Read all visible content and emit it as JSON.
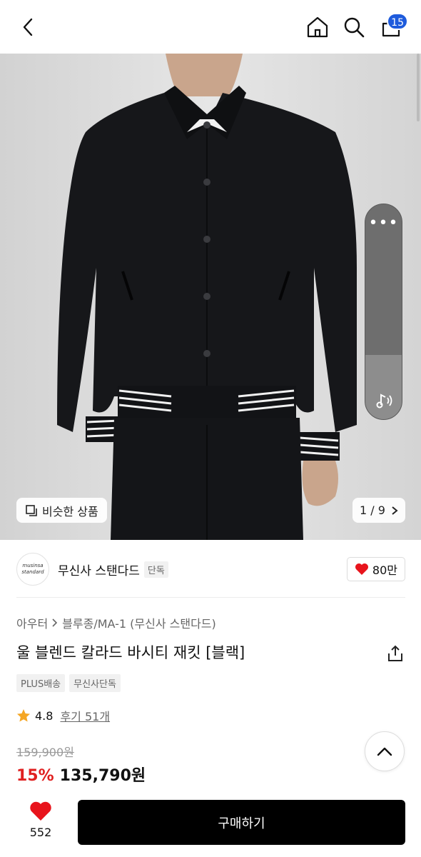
{
  "header": {
    "cart_count": "15"
  },
  "hero": {
    "similar_label": "비슷한 상품",
    "pager_text": "1 / 9",
    "volume_level": 0.3
  },
  "brand": {
    "logo_line1": "musinsa",
    "logo_line2": "standard",
    "name": "무신사 스탠다드",
    "tag": "단독",
    "likes": "80만"
  },
  "product": {
    "breadcrumb": [
      "아우터",
      "블루종/MA-1 (무신사 스탠다드)"
    ],
    "title": "울 블렌드 칼라드 바시티 재킷 [블랙]",
    "tags": [
      "PLUS배송",
      "무신사단독"
    ],
    "rating": "4.8",
    "reviews": "후기 51개",
    "original_price": "159,900원",
    "discount": "15%",
    "price": "135,790원"
  },
  "bottom": {
    "wish_count": "552",
    "buy_label": "구매하기"
  },
  "colors": {
    "accent_red": "#e02020",
    "badge_blue": "#1e5bdc",
    "heart_red": "#e8141c",
    "star": "#f5a623"
  },
  "icons": [
    "back-icon",
    "home-icon",
    "search-icon",
    "cart-icon",
    "more-icon",
    "music-note-icon",
    "similar-icon",
    "chevron-right-icon",
    "heart-icon",
    "share-icon",
    "star-icon",
    "chevron-up-icon"
  ]
}
